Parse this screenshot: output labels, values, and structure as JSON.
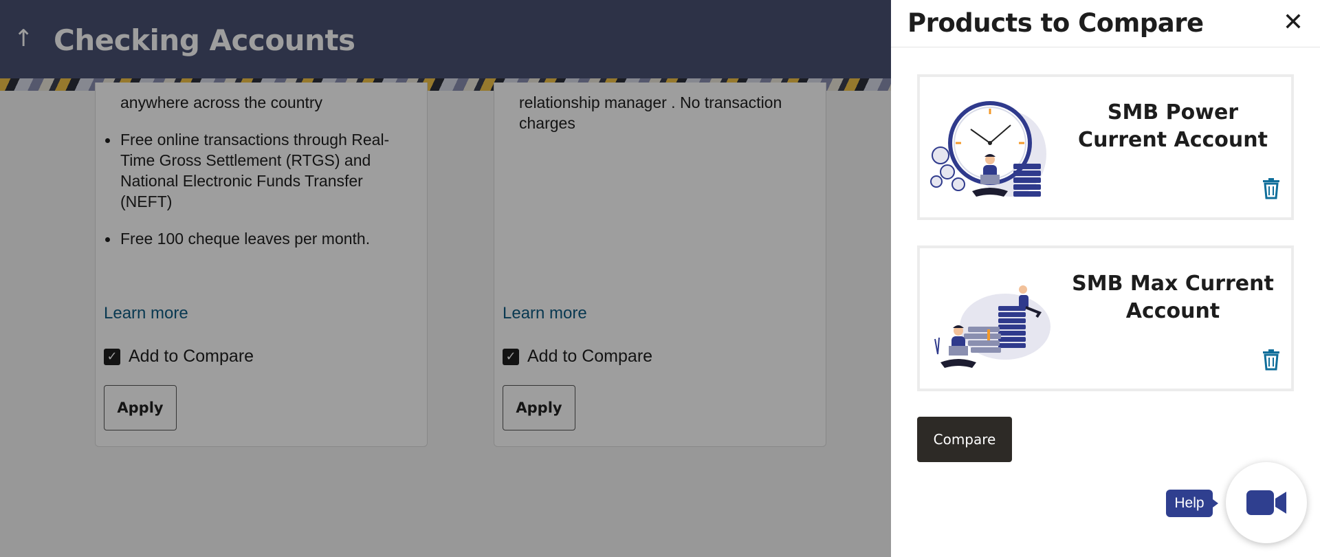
{
  "header": {
    "back_icon": "arrow-up-icon",
    "title": "Checking Accounts"
  },
  "cards": [
    {
      "snippet": "anywhere across the country",
      "bullets": [
        "Free online transactions through Real-Time Gross Settlement (RTGS) and National Electronic Funds Transfer (NEFT)",
        "Free 100 cheque leaves per month."
      ],
      "learn_more": "Learn more",
      "add_to_compare": "Add to Compare",
      "add_to_compare_checked": true,
      "apply": "Apply"
    },
    {
      "snippet": "relationship manager . No transaction charges",
      "learn_more": "Learn more",
      "add_to_compare": "Add to Compare",
      "add_to_compare_checked": true,
      "apply": "Apply"
    }
  ],
  "drawer": {
    "title": "Products to Compare",
    "close_icon": "close-icon",
    "products": [
      {
        "name": "SMB Power Current Account",
        "illustration": "clock-coins-illustration",
        "delete_icon": "trash-icon"
      },
      {
        "name": "SMB Max Current Account",
        "illustration": "coin-stack-illustration",
        "delete_icon": "trash-icon"
      }
    ],
    "compare_button": "Compare"
  },
  "help": {
    "label": "Help",
    "video_icon": "video-camera-icon"
  },
  "colors": {
    "header_bg": "#4a5273",
    "link": "#0f5c84",
    "compare_button_bg": "#2d2a26",
    "help_bg": "#2f3f8f",
    "trash_icon": "#0f6e9a"
  }
}
